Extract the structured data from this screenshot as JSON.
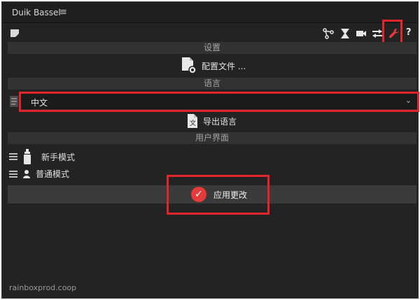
{
  "window": {
    "title": "Duik Bassel",
    "menu_glyph": "≡"
  },
  "toolbar": {
    "left_icon": "note-icon",
    "right_icons": [
      "rig-icon",
      "hourglass-icon",
      "camera-icon",
      "swap-icon",
      "wrench-icon",
      "help-icon"
    ],
    "help_glyph": "?"
  },
  "sections": {
    "settings": {
      "header": "设置",
      "config_button": "配置文件 ..."
    },
    "language": {
      "header": "语言",
      "selected": "中文",
      "export_button": "导出语言"
    },
    "ui": {
      "header": "用户界面",
      "beginner": "新手模式",
      "normal": "普通模式"
    }
  },
  "apply": {
    "label": "应用更改"
  },
  "footer": {
    "text": "rainboxprod.coop"
  },
  "colors": {
    "accent": "#e63a3a",
    "highlight": "#e2252b",
    "panel_bg": "#232323"
  }
}
